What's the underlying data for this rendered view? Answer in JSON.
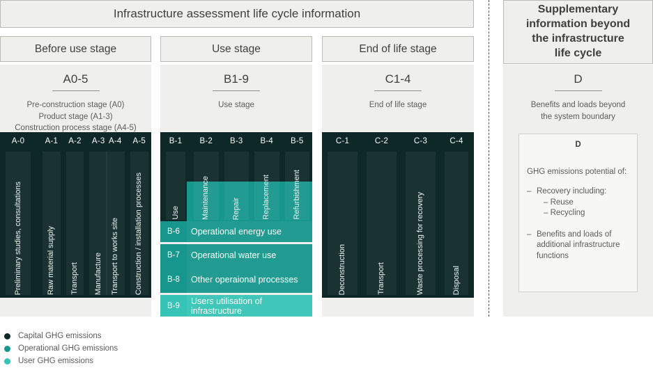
{
  "master_title": "Infrastructure assessment life cycle information",
  "stages": {
    "a": {
      "header": "Before use stage",
      "code": "A0-5",
      "description": "Pre-construction stage (A0)\nProduct stage (A1-3)\nConstruction process stage (A4-5)",
      "desc_lines": [
        "Pre-construction stage (A0)",
        "Product stage (A1-3)",
        "Construction process stage (A4-5)"
      ],
      "groups": [
        {
          "columns": [
            {
              "code": "A-0",
              "label": "Preliminary studies, consultations"
            }
          ]
        },
        {
          "columns": [
            {
              "code": "A-1",
              "label": "Raw material supply"
            },
            {
              "code": "A-2",
              "label": "Transport"
            },
            {
              "code": "A-3",
              "label": "Manufacture"
            }
          ]
        },
        {
          "columns": [
            {
              "code": "A-4",
              "label": "Transport to works site"
            },
            {
              "code": "A-5",
              "label": "Construction / installation processes"
            }
          ]
        }
      ]
    },
    "b": {
      "header": "Use stage",
      "code": "B1-9",
      "description": "Use stage",
      "desc_lines": [
        "Use stage"
      ],
      "groups": [
        {
          "columns": [
            {
              "code": "B-1",
              "label": "Use"
            }
          ]
        },
        {
          "columns": [
            {
              "code": "B-2",
              "label": "Maintenance"
            },
            {
              "code": "B-3",
              "label": "Repair"
            },
            {
              "code": "B-4",
              "label": "Replacement"
            },
            {
              "code": "B-5",
              "label": "Refurbishment"
            }
          ]
        }
      ],
      "operational_rows": [
        {
          "code": "B-6",
          "label": "Operational energy use"
        },
        {
          "code": "B-7",
          "label": "Operational water use"
        },
        {
          "code": "B-8",
          "label": "Other operaional processes"
        },
        {
          "code": "B-9",
          "label": "Users utilisation of infrastructure"
        }
      ]
    },
    "c": {
      "header": "End of life stage",
      "code": "C1-4",
      "description": "End of life stage",
      "desc_lines": [
        "End of life stage"
      ],
      "groups": [
        {
          "columns": [
            {
              "code": "C-1",
              "label": "Deconstruction"
            }
          ]
        },
        {
          "columns": [
            {
              "code": "C-2",
              "label": "Transport"
            }
          ]
        },
        {
          "columns": [
            {
              "code": "C-3",
              "label": "Waste processing for recovery"
            }
          ]
        },
        {
          "columns": [
            {
              "code": "C-4",
              "label": "Disposal"
            }
          ]
        }
      ]
    },
    "d": {
      "header": "Supplementary information beyond the infrastructure life cycle",
      "header_lines": [
        "Supplementary",
        "information beyond",
        "the infrastructure",
        "life cycle"
      ],
      "code": "D",
      "description": "Benefits and loads beyond the system boundary",
      "desc_lines": [
        "Benefits and loads beyond",
        "the system boundary"
      ],
      "card": {
        "letter": "D",
        "intro": "GHG emissions potential of:",
        "bullets": [
          {
            "text": "Recovery including:",
            "subs": [
              "– Reuse",
              "– Recycling"
            ]
          },
          {
            "text": "Benefits and loads of additional infrastructure functions",
            "subs": []
          }
        ]
      }
    }
  },
  "legend": [
    {
      "label": "Capital GHG emissions",
      "color": "#0d2827"
    },
    {
      "label": "Operational GHG emissions",
      "color": "#16968c"
    },
    {
      "label": "User GHG emissions",
      "color": "#35c4b5"
    }
  ],
  "colors": {
    "capital": "#0d2827",
    "operational": "#16968c",
    "user": "#35c4b5",
    "panel_bg": "#efefed",
    "panel_border": "#b9b9b7"
  }
}
